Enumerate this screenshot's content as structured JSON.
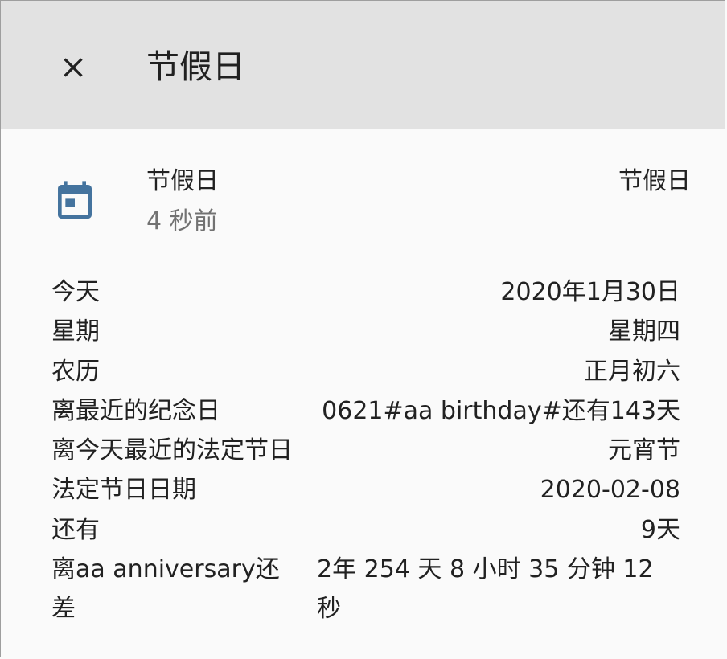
{
  "header": {
    "title": "节假日",
    "close_icon": "close-icon"
  },
  "entity": {
    "icon": "calendar-icon",
    "icon_color": "#44739e",
    "name": "节假日",
    "last_changed": "4 秒前",
    "state": "节假日"
  },
  "attributes": [
    {
      "key": "今天",
      "value": "2020年1月30日"
    },
    {
      "key": "星期",
      "value": "星期四"
    },
    {
      "key": "农历",
      "value": "正月初六"
    },
    {
      "key": "离最近的纪念日",
      "value": "0621#aa birthday#还有143天"
    },
    {
      "key": "离今天最近的法定节日",
      "value": "元宵节"
    },
    {
      "key": "法定节日日期",
      "value": "2020-02-08"
    },
    {
      "key": "还有",
      "value": "9天"
    },
    {
      "key": "离aa anniversary还差",
      "value": "2年 254 天 8 小时 35 分钟 12 秒"
    }
  ]
}
